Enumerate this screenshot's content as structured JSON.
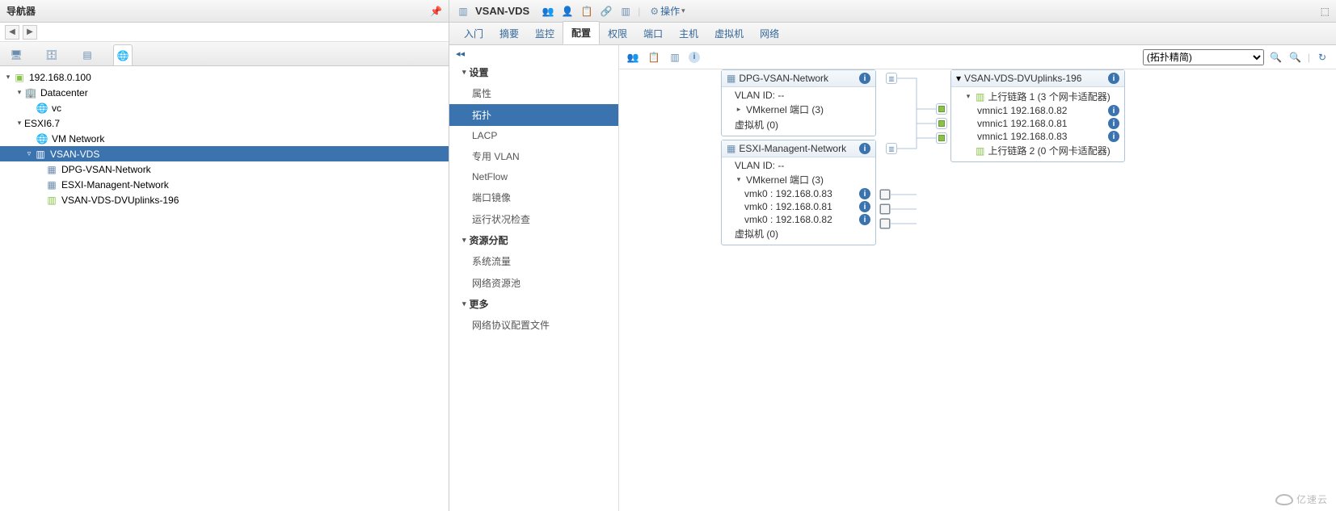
{
  "navigator": {
    "title": "导航器",
    "tree": {
      "root": "192.168.0.100",
      "datacenter": "Datacenter",
      "vc": "vc",
      "esxi": "ESXI6.7",
      "vm_network": "VM Network",
      "vsan_vds": "VSAN-VDS",
      "dpg": "DPG-VSAN-Network",
      "mgmt": "ESXI-Managent-Network",
      "uplinks": "VSAN-VDS-DVUplinks-196"
    }
  },
  "object_header": {
    "title": "VSAN-VDS",
    "actions_label": "操作"
  },
  "tabs": {
    "t0": "入门",
    "t1": "摘要",
    "t2": "监控",
    "t3": "配置",
    "t4": "权限",
    "t5": "端口",
    "t6": "主机",
    "t7": "虚拟机",
    "t8": "网络"
  },
  "sidebar": {
    "collapse": "◂◂",
    "sec_settings": "设置",
    "items_settings": {
      "i0": "属性",
      "i1": "拓扑",
      "i2": "LACP",
      "i3": "专用 VLAN",
      "i4": "NetFlow",
      "i5": "端口镜像",
      "i6": "运行状况检查"
    },
    "sec_resource": "资源分配",
    "items_resource": {
      "i0": "系统流量",
      "i1": "网络资源池"
    },
    "sec_more": "更多",
    "items_more": {
      "i0": "网络协议配置文件"
    }
  },
  "toolbar": {
    "filter_label": "(拓扑精简)"
  },
  "topology": {
    "card_dpg": {
      "title": "DPG-VSAN-Network",
      "vlan": "VLAN ID: --",
      "vmk": "VMkernel 端口 (3)",
      "vms": "虚拟机 (0)"
    },
    "card_mgmt": {
      "title": "ESXI-Managent-Network",
      "vlan": "VLAN ID: --",
      "vmk_hdr": "VMkernel 端口 (3)",
      "vmk0": "vmk0 : 192.168.0.83",
      "vmk1": "vmk0 : 192.168.0.81",
      "vmk2": "vmk0 : 192.168.0.82",
      "vms": "虚拟机 (0)"
    },
    "card_uplinks": {
      "title": "VSAN-VDS-DVUplinks-196",
      "up1": "上行链路 1 (3 个网卡适配器)",
      "nic0": "vmnic1 192.168.0.82",
      "nic1": "vmnic1 192.168.0.81",
      "nic2": "vmnic1 192.168.0.83",
      "up2": "上行链路 2 (0 个网卡适配器)"
    }
  },
  "watermark": "亿速云"
}
